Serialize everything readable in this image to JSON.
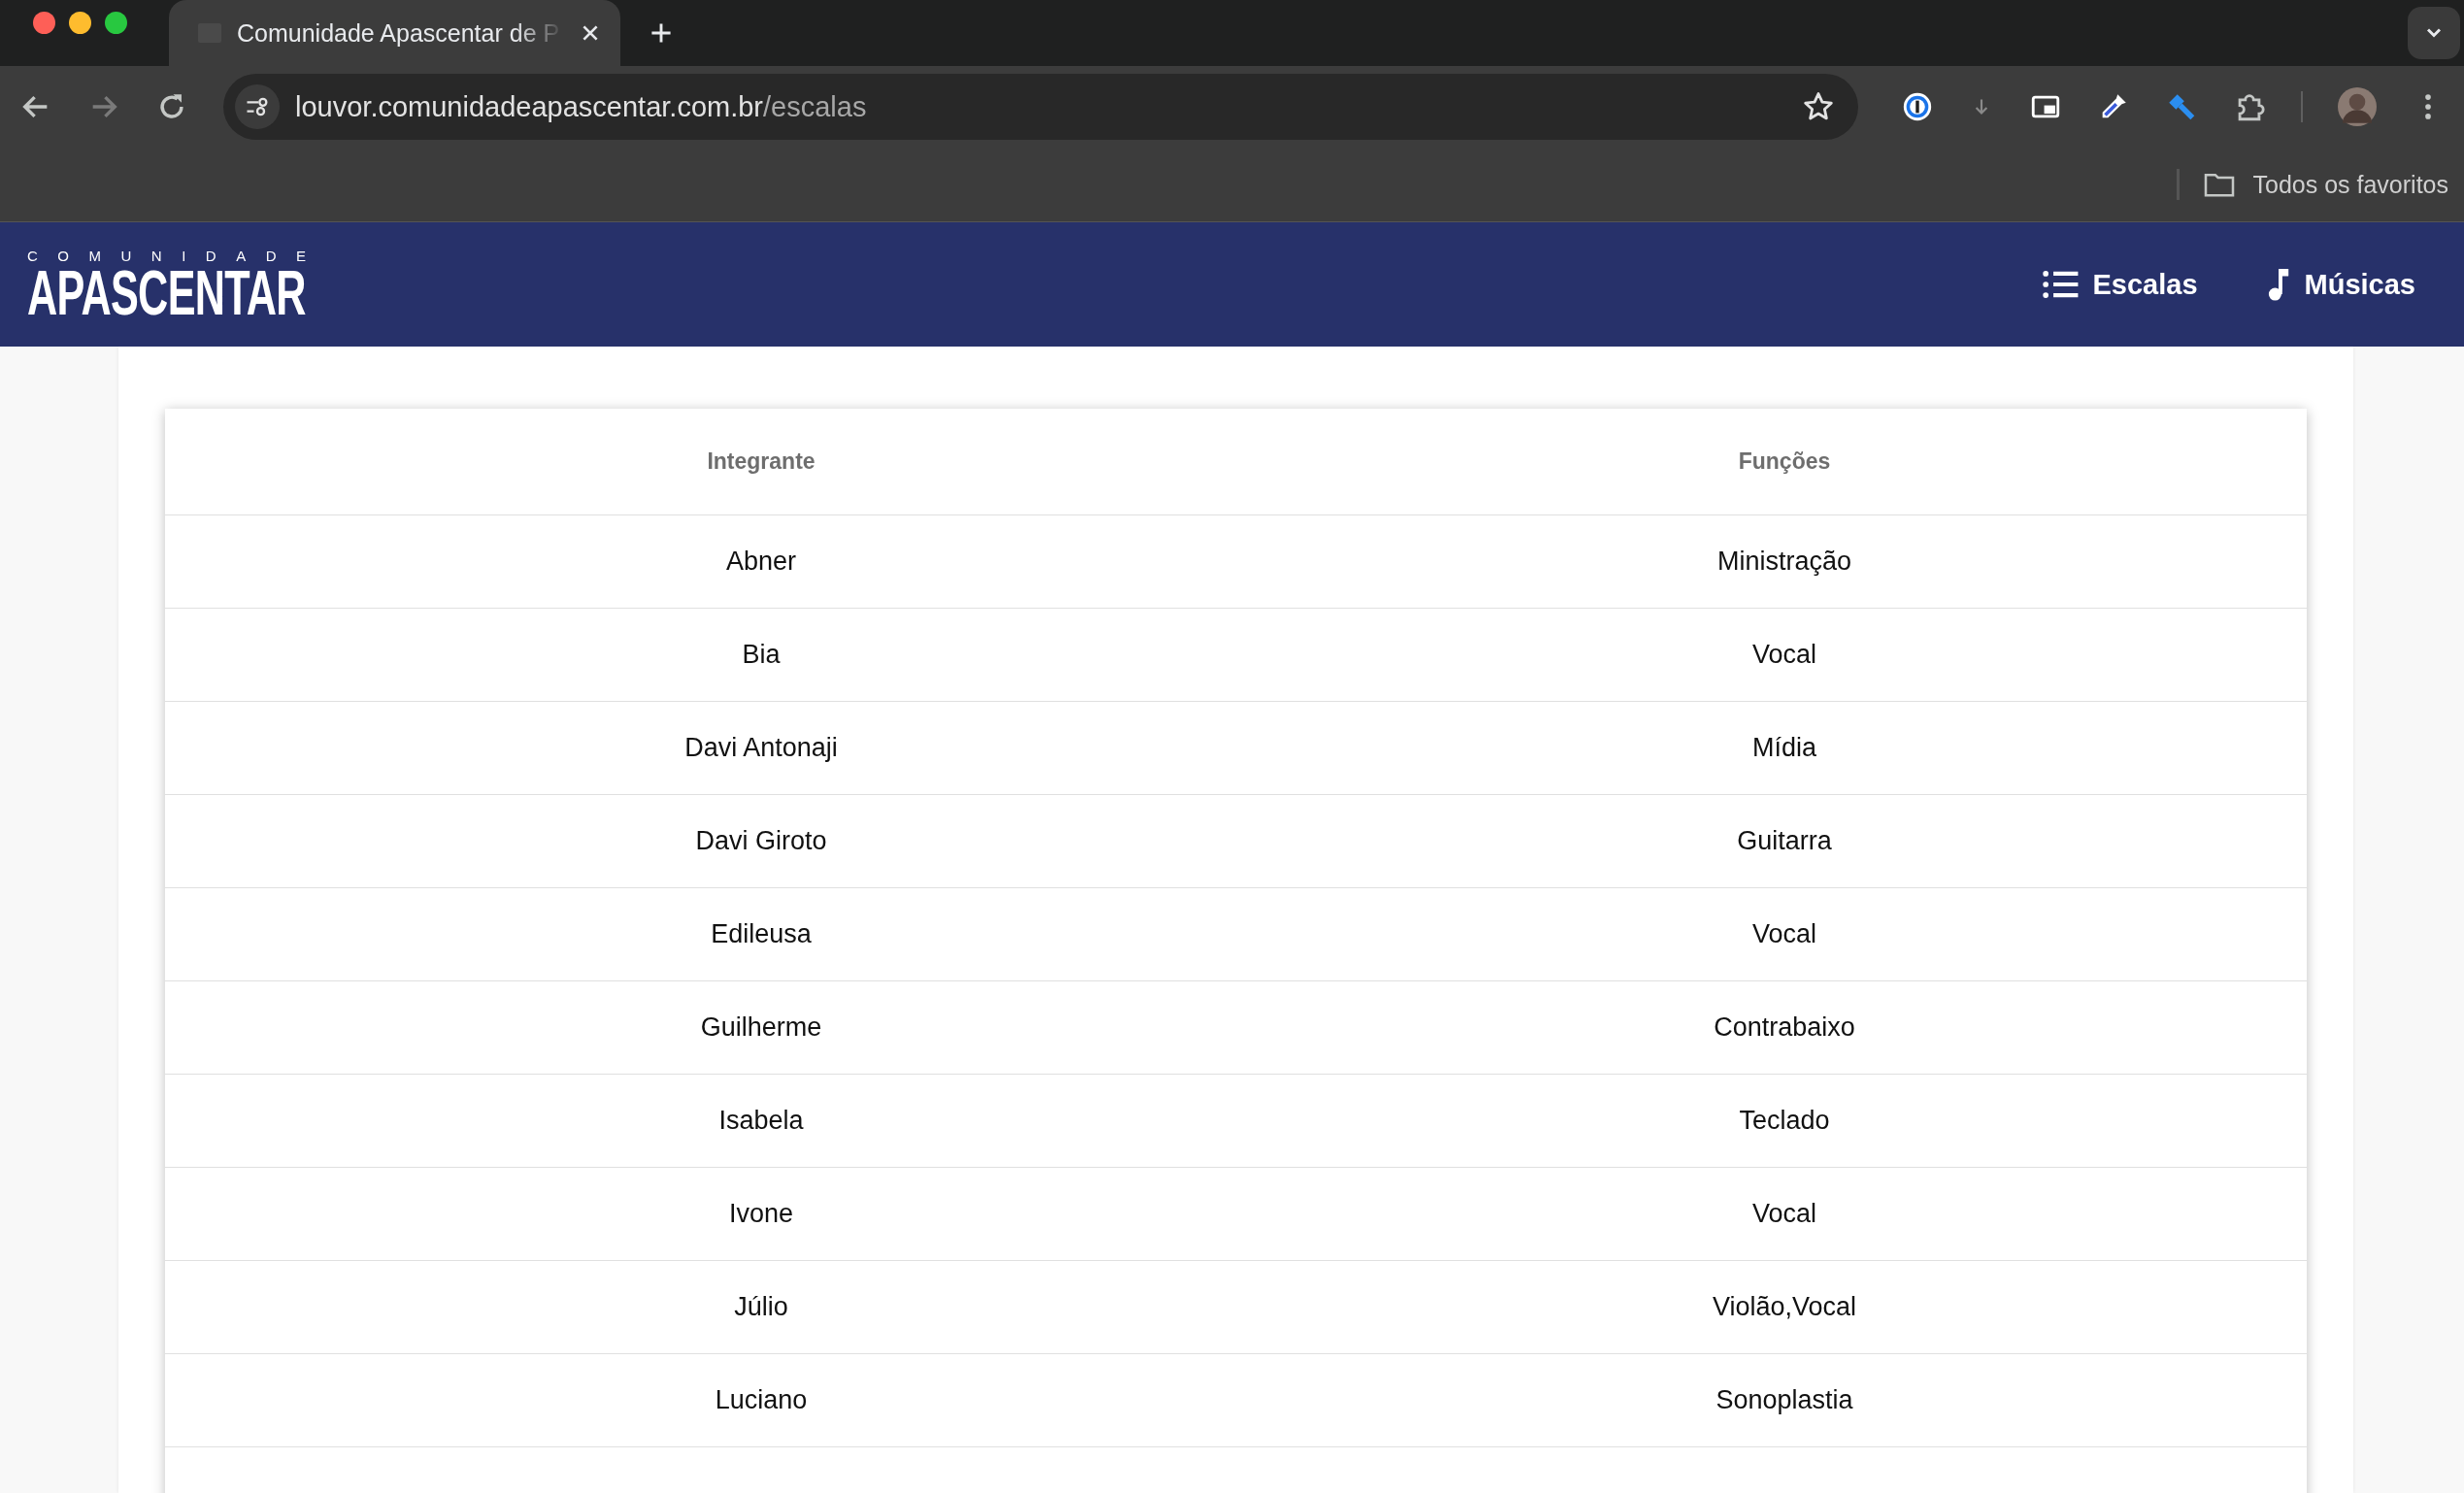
{
  "browser": {
    "tab": {
      "title": "Comunidade Apascentar de P",
      "selected": true
    },
    "url": {
      "host": "louvor.comunidadeapascentar.com.br",
      "path": "/escalas"
    },
    "bookmarks": "Todos os favoritos"
  },
  "site": {
    "logo": {
      "small": "COMUNIDADE",
      "big": "APASCENTAR"
    },
    "nav": [
      {
        "label": "Escalas",
        "kind": "list"
      },
      {
        "label": "Músicas",
        "kind": "music"
      }
    ]
  },
  "table": {
    "columns": [
      "Integrante",
      "Funções"
    ],
    "rows": [
      [
        "Abner",
        "Ministração"
      ],
      [
        "Bia",
        "Vocal"
      ],
      [
        "Davi Antonaji",
        "Mídia"
      ],
      [
        "Davi Giroto",
        "Guitarra"
      ],
      [
        "Edileusa",
        "Vocal"
      ],
      [
        "Guilherme",
        "Contrabaixo"
      ],
      [
        "Isabela",
        "Teclado"
      ],
      [
        "Ivone",
        "Vocal"
      ],
      [
        "Júlio",
        "Violão,Vocal"
      ],
      [
        "Luciano",
        "Sonoplastia"
      ]
    ]
  }
}
